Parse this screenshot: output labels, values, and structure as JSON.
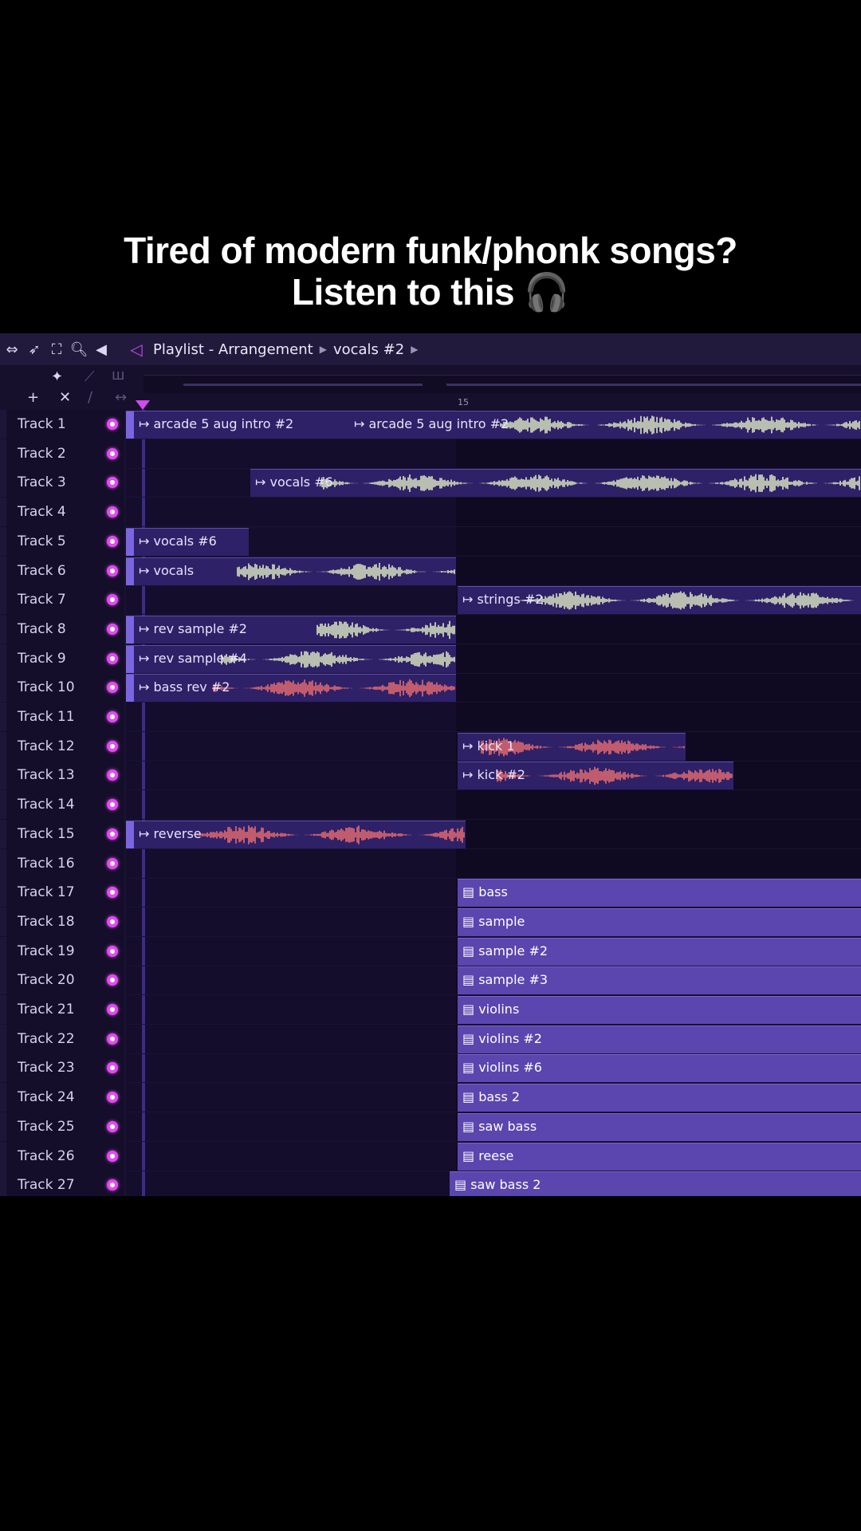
{
  "caption": {
    "line1": "Tired of modern funk/phonk songs?",
    "line2": "Listen to this 🎧"
  },
  "titlebar": {
    "app_title": "Playlist - Arrangement",
    "breadcrumb": "vocals #2",
    "icons": [
      "arrows-icon",
      "pointer-icon",
      "fullscreen-icon",
      "zoom-icon",
      "speaker-icon"
    ]
  },
  "ruler": {
    "bar_marker": "15"
  },
  "tracks": [
    "Track 1",
    "Track 2",
    "Track 3",
    "Track 4",
    "Track 5",
    "Track 6",
    "Track 7",
    "Track 8",
    "Track 9",
    "Track 10",
    "Track 11",
    "Track 12",
    "Track 13",
    "Track 14",
    "Track 15",
    "Track 16",
    "Track 17",
    "Track 18",
    "Track 19",
    "Track 20",
    "Track 21",
    "Track 22",
    "Track 23",
    "Track 24",
    "Track 25",
    "Track 26",
    "Track 27"
  ],
  "clips": {
    "arcade1": "arcade 5 aug intro #2",
    "arcade2": "arcade 5 aug intro #2",
    "vocals6": "vocals #6",
    "vocals5": "vocals #6",
    "vocals": "vocals",
    "strings": "strings #2",
    "rev1": "rev sample #2",
    "rev2": "rev sample #4",
    "bassrev": "bass rev #2",
    "kick1": "kick 1",
    "kick2": "kick #2",
    "reverse": "reverse",
    "bass": "bass",
    "sample": "sample",
    "sample2": "sample #2",
    "sample3": "sample #3",
    "violins": "violins",
    "violins2": "violins #2",
    "violins6": "violins #6",
    "bass2": "bass 2",
    "sawbass": "saw bass",
    "reese": "reese",
    "sawbass2": "saw bass 2"
  },
  "colors": {
    "accent": "#e04cf0",
    "pattern_clip": "#5a46ae",
    "audio_clip": "#2e2168",
    "wave_light": "#e6f3c8",
    "wave_red": "#f07070"
  }
}
